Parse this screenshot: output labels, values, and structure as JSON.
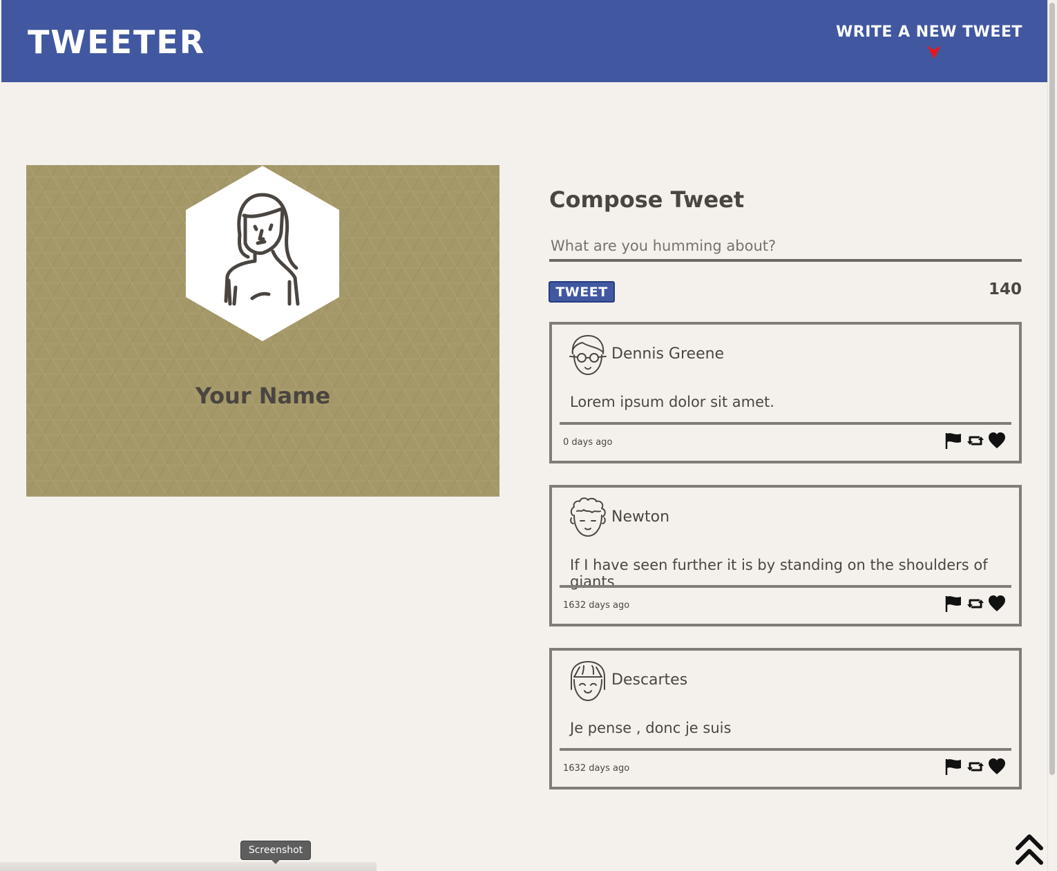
{
  "header": {
    "brand": "TWEETER",
    "write_link": "WRITE A NEW TWEET",
    "arrow_icon": "arrow-down-icon",
    "arrow_color": "#e8161b",
    "background": "#4158a0"
  },
  "profile": {
    "name": "Your Name",
    "avatar_icon": "woman-avatar-icon",
    "background": "#a59868"
  },
  "compose": {
    "title": "Compose Tweet",
    "placeholder": "What are you humming about?",
    "button_label": "TWEET",
    "char_count": "140"
  },
  "tweets": [
    {
      "author": "Dennis Greene",
      "avatar_icon": "man-glasses-avatar-icon",
      "content": "Lorem ipsum dolor sit amet.",
      "time": "0 days ago"
    },
    {
      "author": "Newton",
      "avatar_icon": "curly-hair-avatar-icon",
      "content": "If I have seen further it is by standing on the shoulders of giants",
      "time": "1632 days ago"
    },
    {
      "author": "Descartes",
      "avatar_icon": "bangs-avatar-icon",
      "content": "Je pense , donc je suis",
      "time": "1632 days ago"
    }
  ],
  "tweet_actions": [
    "flag-icon",
    "retweet-icon",
    "heart-icon"
  ],
  "tooltip": {
    "label": "Screenshot"
  },
  "back_to_top_icon": "double-chevron-up-icon"
}
